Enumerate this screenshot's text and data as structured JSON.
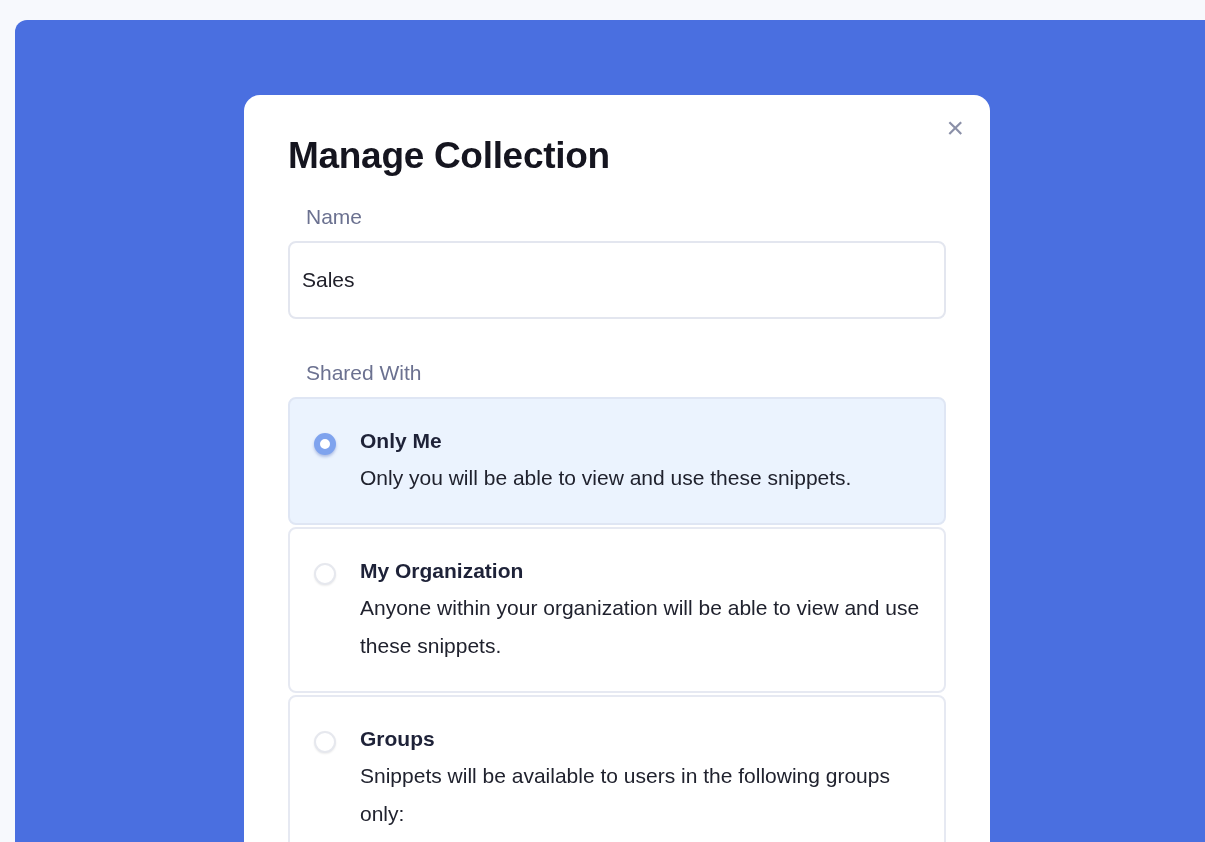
{
  "dialog": {
    "title": "Manage Collection",
    "close": "×"
  },
  "name_field": {
    "label": "Name",
    "value": "Sales"
  },
  "shared_with": {
    "label": "Shared With",
    "options": [
      {
        "title": "Only Me",
        "description": "Only you will be able to view and use these snippets.",
        "selected": true
      },
      {
        "title": "My Organization",
        "description": "Anyone within your organization will be able to view and use these snippets.",
        "selected": false
      },
      {
        "title": "Groups",
        "description": "Snippets will be available to users in the following groups only:",
        "selected": false
      }
    ]
  }
}
